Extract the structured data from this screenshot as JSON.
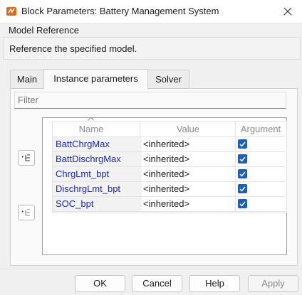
{
  "window": {
    "title": "Block Parameters: Battery Management System"
  },
  "block": {
    "type_title": "Model Reference",
    "description": "Reference the specified model."
  },
  "tabs": [
    {
      "label": "Main",
      "active": false
    },
    {
      "label": "Instance parameters",
      "active": true
    },
    {
      "label": "Solver",
      "active": false
    }
  ],
  "filter": {
    "placeholder": "Filter",
    "value": ""
  },
  "table": {
    "columns": [
      "Name",
      "Value",
      "Argument"
    ],
    "sort_column": "Name",
    "rows": [
      {
        "name": "BattChrgMax",
        "value": "<inherited>",
        "argument": true
      },
      {
        "name": "BattDischrgMax",
        "value": "<inherited>",
        "argument": true
      },
      {
        "name": "ChrgLmt_bpt",
        "value": "<inherited>",
        "argument": true
      },
      {
        "name": "DischrgLmt_bpt",
        "value": "<inherited>",
        "argument": true
      },
      {
        "name": "SOC_bpt",
        "value": "<inherited>",
        "argument": true
      }
    ]
  },
  "side_buttons": {
    "expand_icon": "expand-tree-icon",
    "collapse_icon": "collapse-tree-icon"
  },
  "buttons": {
    "ok": "OK",
    "cancel": "Cancel",
    "help": "Help",
    "apply": "Apply"
  },
  "colors": {
    "link_name": "#1b28c4",
    "checkbox": "#1e5dbf"
  }
}
